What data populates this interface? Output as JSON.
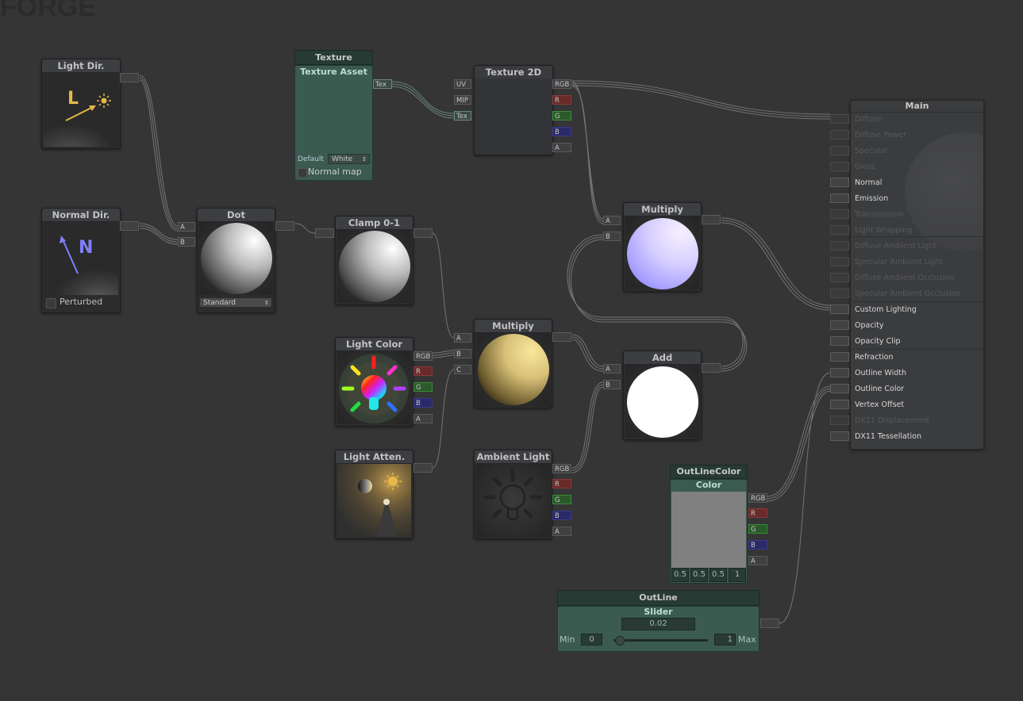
{
  "app": {
    "logo_text": "FORGE"
  },
  "nodes": {
    "light_dir": {
      "title": "Light Dir.",
      "glyph_letter": "L"
    },
    "normal_dir": {
      "title": "Normal Dir.",
      "glyph_letter": "N",
      "checkbox_label": "Perturbed",
      "checkbox_checked": false
    },
    "texture_asset": {
      "group_title": "Texture",
      "title": "Texture Asset",
      "out_port": "Tex",
      "default_label": "Default",
      "default_value": "White",
      "normal_map_label": "Normal map",
      "normal_map_checked": false
    },
    "texture_2d": {
      "title": "Texture 2D",
      "inputs": [
        "UV",
        "MIP",
        "Tex"
      ],
      "outputs": [
        "RGB",
        "R",
        "G",
        "B",
        "A"
      ]
    },
    "dot": {
      "title": "Dot",
      "inputs": [
        "A",
        "B"
      ],
      "mode_value": "Standard"
    },
    "clamp": {
      "title": "Clamp 0-1"
    },
    "multiply_top": {
      "title": "Multiply",
      "inputs": [
        "A",
        "B"
      ]
    },
    "light_color": {
      "title": "Light Color",
      "outputs": [
        "RGB",
        "R",
        "G",
        "B",
        "A"
      ]
    },
    "multiply_mid": {
      "title": "Multiply",
      "inputs": [
        "A",
        "B",
        "C"
      ]
    },
    "add": {
      "title": "Add",
      "inputs": [
        "A",
        "B"
      ]
    },
    "light_atten": {
      "title": "Light Atten."
    },
    "ambient_light": {
      "title": "Ambient Light",
      "outputs": [
        "RGB",
        "R",
        "G",
        "B",
        "A"
      ]
    },
    "outline_color": {
      "group_title": "OutLineColor",
      "title": "Color",
      "outputs": [
        "RGB",
        "R",
        "G",
        "B",
        "A"
      ],
      "values": [
        "0.5",
        "0.5",
        "0.5",
        "1"
      ],
      "swatch_color": "#808080"
    },
    "outline_slider": {
      "group_title": "OutLine",
      "title": "Slider",
      "value": "0.02",
      "min_label": "Min",
      "min_value": "0",
      "max_label": "Max",
      "max_value": "1",
      "fraction": 0.02
    }
  },
  "main": {
    "title": "Main",
    "inputs": [
      {
        "label": "Diffuse",
        "enabled": false,
        "connected": true
      },
      {
        "label": "Diffuse Power",
        "enabled": false,
        "connected": false
      },
      {
        "label": "Specular",
        "enabled": false,
        "connected": false
      },
      {
        "label": "Gloss",
        "enabled": false,
        "connected": false
      },
      {
        "label": "Normal",
        "enabled": true,
        "connected": false
      },
      {
        "label": "Emission",
        "enabled": true,
        "connected": false
      },
      {
        "label": "Transmission",
        "enabled": false,
        "connected": false
      },
      {
        "label": "Light Wrapping",
        "enabled": false,
        "connected": false
      },
      {
        "label": "Diffuse Ambient Light",
        "enabled": false,
        "connected": false
      },
      {
        "label": "Specular Ambient Light",
        "enabled": false,
        "connected": false
      },
      {
        "label": "Diffuse Ambient Occlusion",
        "enabled": false,
        "connected": false
      },
      {
        "label": "Specular Ambient Occlusion",
        "enabled": false,
        "connected": false
      },
      {
        "label": "Custom Lighting",
        "enabled": true,
        "connected": true
      },
      {
        "label": "Opacity",
        "enabled": true,
        "connected": false
      },
      {
        "label": "Opacity Clip",
        "enabled": true,
        "connected": false
      },
      {
        "label": "Refraction",
        "enabled": true,
        "connected": false
      },
      {
        "label": "Outline Width",
        "enabled": true,
        "connected": true
      },
      {
        "label": "Outline Color",
        "enabled": true,
        "connected": true
      },
      {
        "label": "Vertex Offset",
        "enabled": true,
        "connected": false
      },
      {
        "label": "DX11 Displacement",
        "enabled": false,
        "connected": false
      },
      {
        "label": "DX11 Tessellation",
        "enabled": true,
        "connected": false
      }
    ]
  },
  "colors": {
    "port_r": "#6a2a2a",
    "port_g": "#2a5a2a",
    "port_b": "#2a2a6a",
    "property_node": "#3b5a50",
    "wire": "#8a8a8a"
  }
}
